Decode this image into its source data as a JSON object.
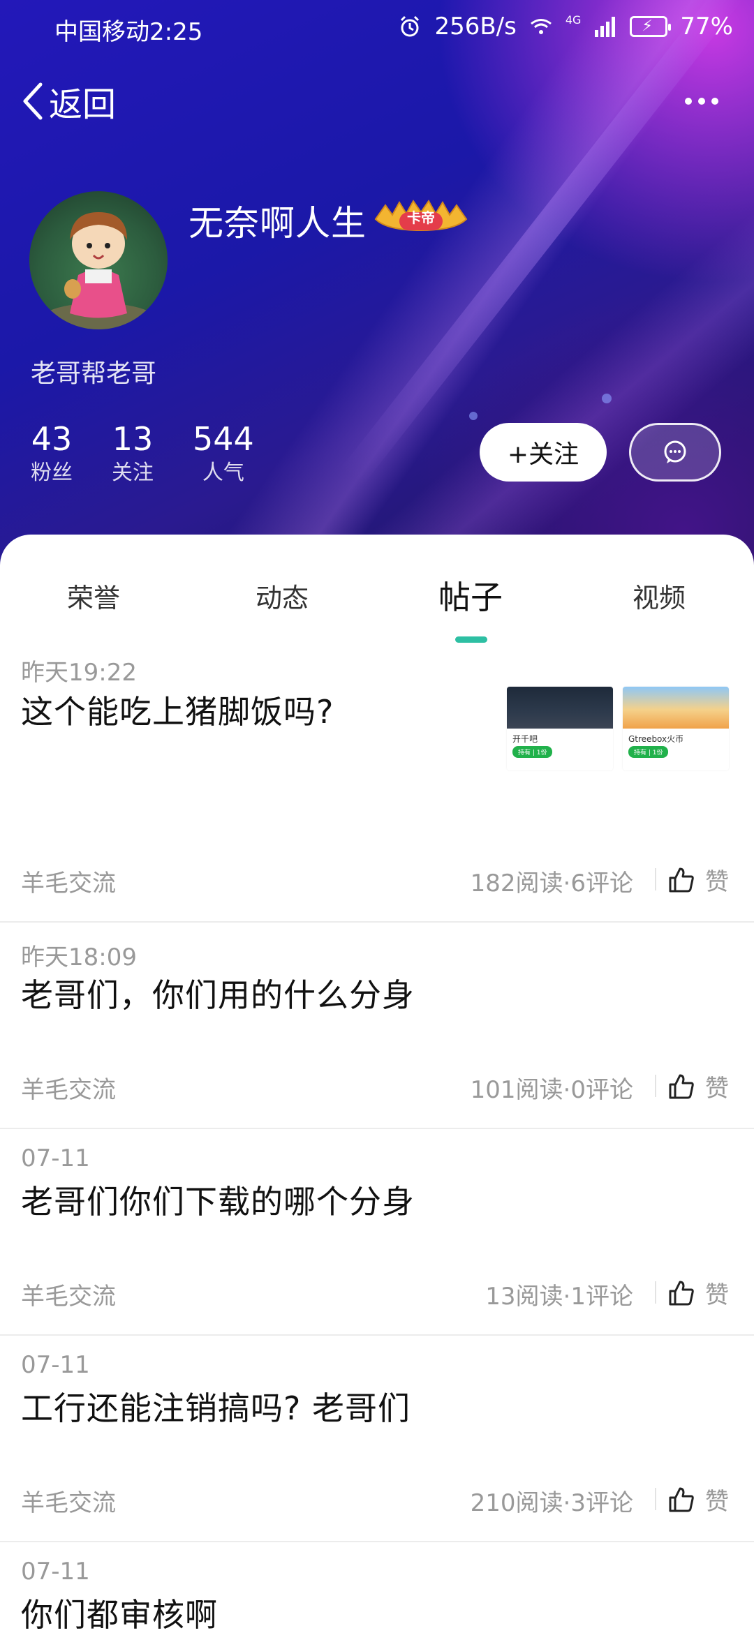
{
  "status_bar": {
    "carrier_time": "中国移动2:25",
    "net_speed": "256B/s",
    "signal": "4G",
    "battery": "77%"
  },
  "nav": {
    "back_label": "返回"
  },
  "profile": {
    "name": "无奈啊人生",
    "vip_badge": "卡帝",
    "signature": "老哥帮老哥",
    "stats": [
      {
        "value": "43",
        "label": "粉丝"
      },
      {
        "value": "13",
        "label": "关注"
      },
      {
        "value": "544",
        "label": "人气"
      }
    ],
    "follow_label": "+关注"
  },
  "tabs": [
    {
      "label": "荣誉"
    },
    {
      "label": "动态"
    },
    {
      "label": "帖子",
      "active": true
    },
    {
      "label": "视频"
    }
  ],
  "posts": [
    {
      "date": "昨天19:22",
      "title": "这个能吃上猪脚饭吗?",
      "category": "羊毛交流",
      "meta": "182阅读·6评论",
      "like": "赞",
      "thumbnails": [
        {
          "caption": "开千吧",
          "tag": "持有 | 1份"
        },
        {
          "caption": "Gtreebox火币",
          "tag": "持有 | 1份"
        }
      ]
    },
    {
      "date": "昨天18:09",
      "title": "老哥们，你们用的什么分身",
      "category": "羊毛交流",
      "meta": "101阅读·0评论",
      "like": "赞"
    },
    {
      "date": "07-11",
      "title": "老哥们你们下载的哪个分身",
      "category": "羊毛交流",
      "meta": "13阅读·1评论",
      "like": "赞"
    },
    {
      "date": "07-11",
      "title": "工行还能注销搞吗? 老哥们",
      "category": "羊毛交流",
      "meta": "210阅读·3评论",
      "like": "赞"
    },
    {
      "date": "07-11",
      "title": "你们都审核啊"
    }
  ]
}
